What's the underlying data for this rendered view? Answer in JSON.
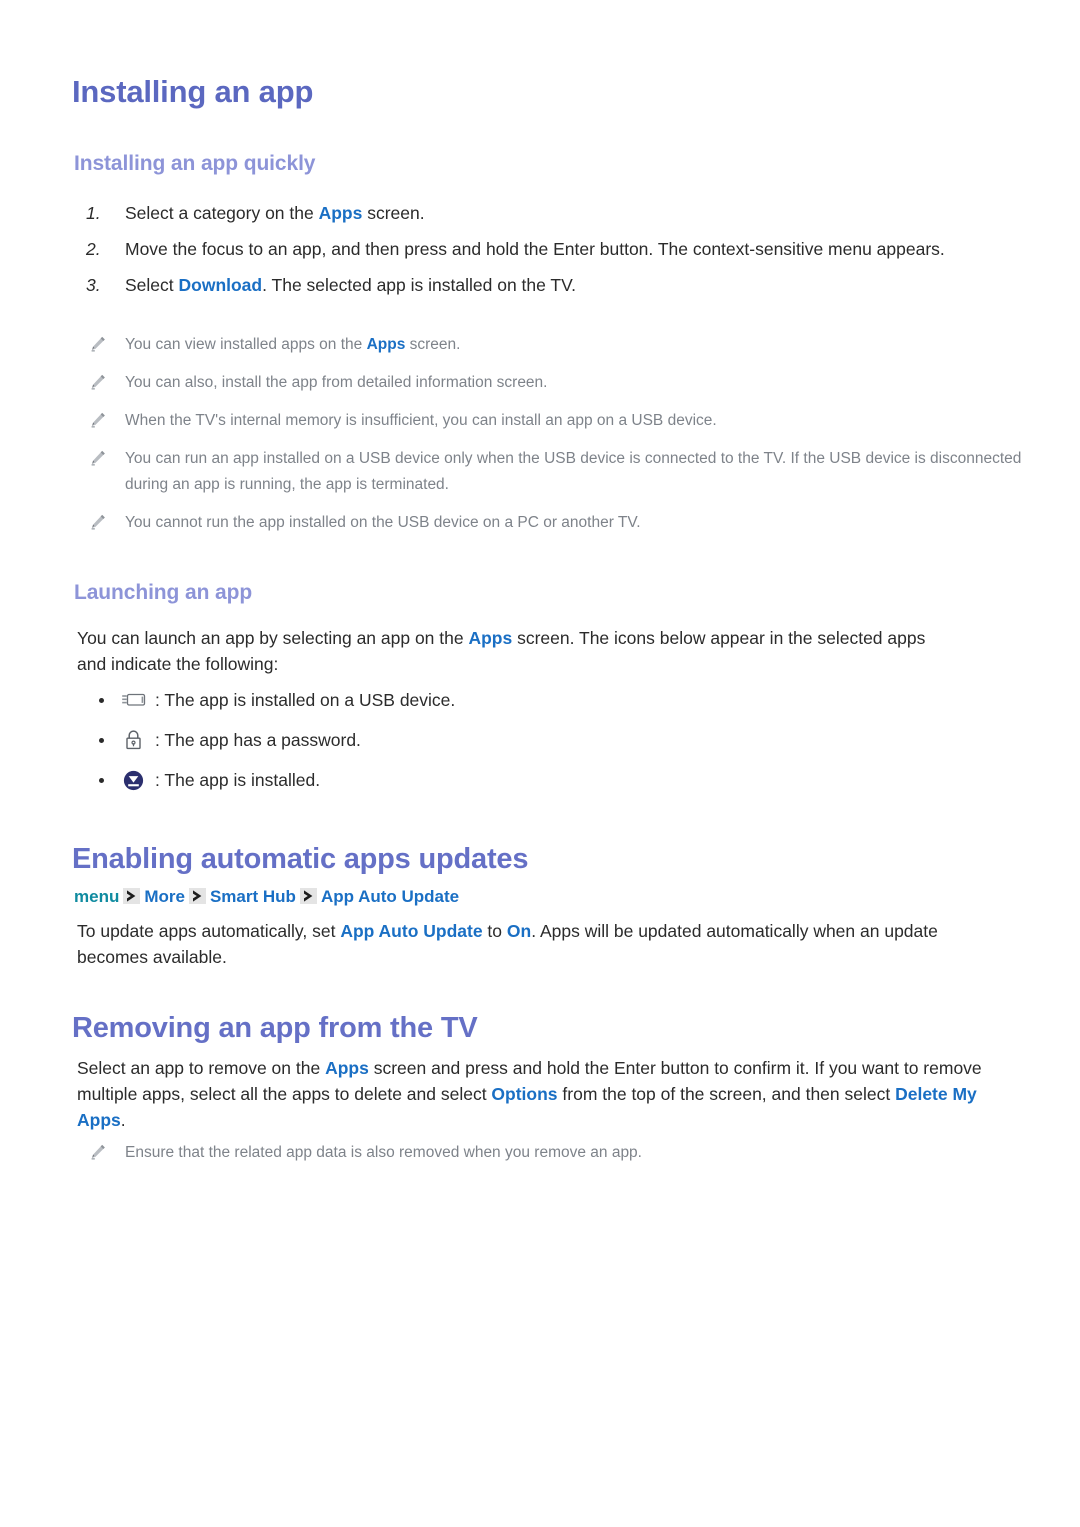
{
  "document": {
    "title": "Installing an app",
    "sections": [
      {
        "id": "installing-an-app",
        "heading": "Installing an app",
        "subheading": "Installing an app quickly"
      }
    ]
  },
  "steps": {
    "items": [
      {
        "num": "1.",
        "pre": "Select a category on the ",
        "link": "Apps",
        "post": " screen."
      },
      {
        "num": "2.",
        "pre": "Move the focus to an app, and then press and hold the Enter button. The context-sensitive menu appears.",
        "link": "",
        "post": ""
      },
      {
        "num": "3.",
        "pre": "Select ",
        "link": "Download",
        "post": ". The selected app is installed on the TV."
      }
    ]
  },
  "notes_install": {
    "icon": "pencil-icon",
    "items": [
      {
        "pre": "You can view installed apps on the ",
        "link": "Apps",
        "post": " screen."
      },
      {
        "pre": "You can also, install the app from detailed information screen.",
        "link": "",
        "post": ""
      },
      {
        "pre": "When the TV's internal memory is insufficient, you can install an app on a USB device.",
        "link": "",
        "post": ""
      },
      {
        "pre": "You can run an app installed on a USB device only when the USB device is connected to the TV. If the USB device is disconnected during an app is running, the app is terminated.",
        "link": "",
        "post": ""
      },
      {
        "pre": "You cannot run the app installed on the USB device on a PC or another TV.",
        "link": "",
        "post": ""
      }
    ]
  },
  "launching": {
    "heading": "Launching an app",
    "intro_pre": "You can launch an app by selecting an app on the ",
    "intro_link": "Apps",
    "intro_post": " screen. The icons below appear in the selected apps and indicate the following:",
    "icon_items": [
      {
        "icon": "usb-device-icon",
        "text": ": The app is installed on a USB device."
      },
      {
        "icon": "lock-icon",
        "text": ": The app has a password."
      },
      {
        "icon": "download-badge-icon",
        "text": ": The app is installed."
      }
    ]
  },
  "auto_update": {
    "heading": "Enabling automatic apps updates",
    "breadcrumb": {
      "root": "menu",
      "items": [
        "More",
        "Smart Hub",
        "App Auto Update"
      ],
      "separator_icon": "chevron-right-icon"
    },
    "body_pre": "To update apps automatically, set ",
    "body_link1": "App Auto Update",
    "body_mid": " to ",
    "body_link2": "On",
    "body_post": ". Apps will be updated automatically when an update becomes available."
  },
  "removing": {
    "heading": "Removing an app from the TV",
    "body_p1": "Select an app to remove on the ",
    "body_l1": "Apps",
    "body_p2": " screen and press and hold the Enter button to confirm it. If you want to remove multiple apps, select all the apps to delete and select ",
    "body_l2": "Options",
    "body_p3": " from the top of the screen, and then select ",
    "body_l3": "Delete My Apps",
    "body_p4": ".",
    "note": {
      "icon": "pencil-icon",
      "text": "Ensure that the related app data is also removed when you remove an app."
    }
  },
  "colors": {
    "heading_primary": "#5b68c0",
    "heading_secondary": "#8d94d8",
    "link_blue": "#1a6fc4",
    "breadcrumb_teal": "#108ba0",
    "note_gray": "#7e838a",
    "body_text": "#2b2b2b",
    "badge_navy": "#2b2f6e"
  }
}
